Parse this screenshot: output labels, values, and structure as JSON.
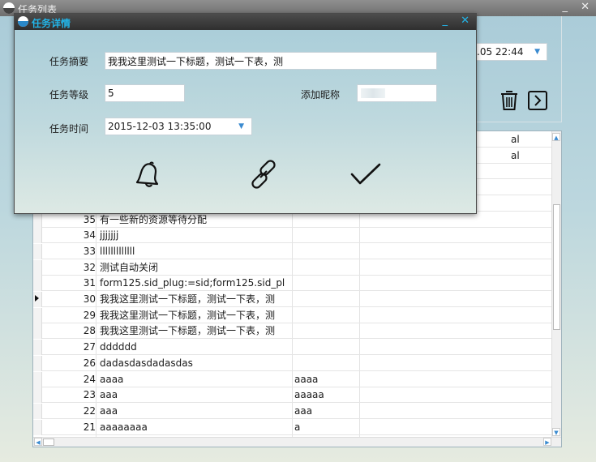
{
  "outer_window": {
    "title": "任务列表",
    "controls": [
      "_",
      "✕"
    ]
  },
  "toolbar": {
    "date_value": ".05 22:44",
    "dropdown_arrow": "▼",
    "delete_icon": "trash-icon",
    "next_icon": "arrow-right-box-icon"
  },
  "grid": {
    "rows": [
      {
        "id": "",
        "title": "",
        "extra": "",
        "right": "al"
      },
      {
        "id": "",
        "title": "",
        "extra": "",
        "right": "al"
      },
      {
        "id": "",
        "title": "",
        "extra": "",
        "right": ""
      },
      {
        "id": "",
        "title": "",
        "extra": "",
        "right": ""
      },
      {
        "id": "",
        "title": "",
        "extra": "",
        "right": ""
      },
      {
        "id": "35",
        "title": "有一些新的资源等待分配",
        "extra": "",
        "right": ""
      },
      {
        "id": "34",
        "title": "jjjjjjj",
        "extra": "",
        "right": ""
      },
      {
        "id": "33",
        "title": "lllllllllllll",
        "extra": "",
        "right": ""
      },
      {
        "id": "32",
        "title": "测试自动关闭",
        "extra": "",
        "right": ""
      },
      {
        "id": "31",
        "title": "form125.sid_plug:=sid;form125.sid_pl",
        "extra": "",
        "right": ""
      },
      {
        "id": "30",
        "title": "我我这里测试一下标题，测试一下表，测",
        "extra": "",
        "right": ""
      },
      {
        "id": "29",
        "title": "我我这里测试一下标题，测试一下表，测",
        "extra": "",
        "right": ""
      },
      {
        "id": "28",
        "title": "我我这里测试一下标题，测试一下表，测",
        "extra": "",
        "right": ""
      },
      {
        "id": "27",
        "title": "dddddd",
        "extra": "",
        "right": ""
      },
      {
        "id": "26",
        "title": "dadasdasdadasdas",
        "extra": "",
        "right": ""
      },
      {
        "id": "24",
        "title": "aaaa",
        "extra": "aaaa",
        "right": ""
      },
      {
        "id": "23",
        "title": "aaa",
        "extra": "aaaaa",
        "right": ""
      },
      {
        "id": "22",
        "title": "aaa",
        "extra": "aaa",
        "right": ""
      },
      {
        "id": "21",
        "title": "aaaaaaaa",
        "extra": "a",
        "right": ""
      }
    ],
    "current_row_index": 10,
    "scroll_up": "▲",
    "scroll_down": "▼",
    "scroll_left": "◀",
    "scroll_right": "▶"
  },
  "dialog": {
    "title": "任务详情",
    "controls": [
      "_",
      "✕"
    ],
    "summary_label": "任务摘要",
    "summary_value": "我我这里测试一下标题，测试一下表，测",
    "level_label": "任务等级",
    "level_value": "5",
    "nickname_label": "添加昵称",
    "time_label": "任务时间",
    "time_value": "2015-12-03 13:35:00",
    "time_arrow": "▼",
    "actions": [
      "bell-icon",
      "link-icon",
      "check-icon"
    ]
  }
}
